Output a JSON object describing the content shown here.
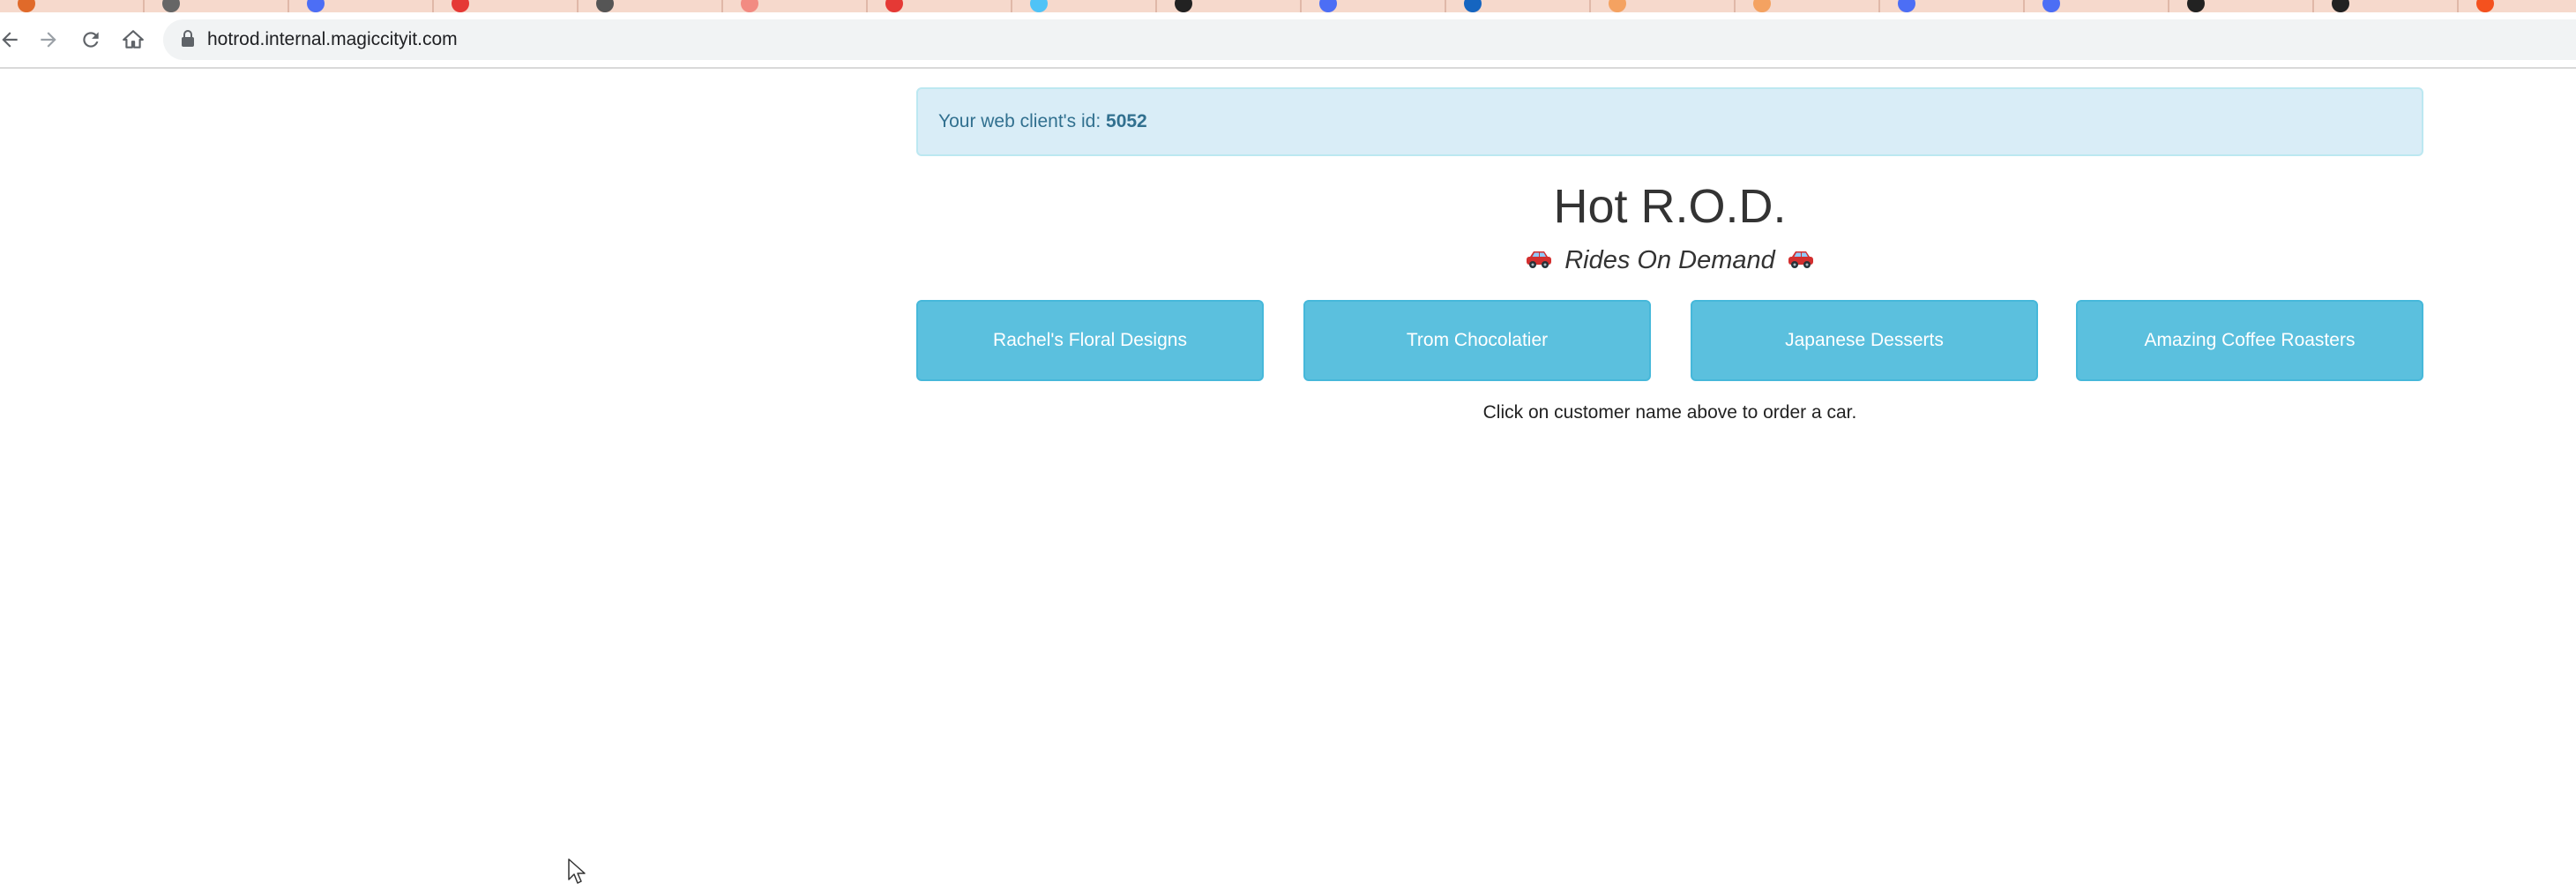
{
  "browser": {
    "url": "hotrod.internal.magiccityit.com",
    "tab_colors": [
      "#e06a2a",
      "#666666",
      "#4c6ef5",
      "#e53935",
      "#555555",
      "#f28b82",
      "#e53935",
      "#4fc3f7",
      "#222222",
      "#4c6ef5",
      "#1565c0",
      "#f4a261",
      "#f4a261",
      "#4c6ef5",
      "#4c6ef5",
      "#222222",
      "#222222",
      "#f4511e"
    ]
  },
  "alert": {
    "label": "Your web client's id:",
    "client_id": "5052"
  },
  "title": "Hot R.O.D.",
  "subtitle": "Rides On Demand",
  "customers": [
    {
      "label": "Rachel's Floral Designs"
    },
    {
      "label": "Trom Chocolatier"
    },
    {
      "label": "Japanese Desserts"
    },
    {
      "label": "Amazing Coffee Roasters"
    }
  ],
  "instruction": "Click on customer name above to order a car.",
  "colors": {
    "alert_bg": "#d9edf7",
    "alert_text": "#31708f",
    "button_bg": "#5bc0de",
    "button_text": "#ffffff"
  }
}
